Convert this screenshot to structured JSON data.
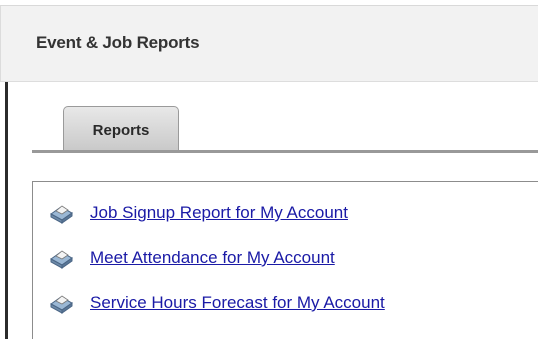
{
  "header": {
    "title": "Event & Job Reports"
  },
  "tabs": [
    {
      "label": "Reports",
      "active": true
    }
  ],
  "reports": [
    {
      "label": "Job Signup Report for My Account",
      "icon": "printer-icon"
    },
    {
      "label": "Meet Attendance for My Account",
      "icon": "printer-icon"
    },
    {
      "label": "Service Hours Forecast for My Account",
      "icon": "printer-icon"
    }
  ],
  "colors": {
    "link": "#1a1aa6",
    "header_bg": "#f2f2f2",
    "tab_bg": "#d4d4d4"
  }
}
